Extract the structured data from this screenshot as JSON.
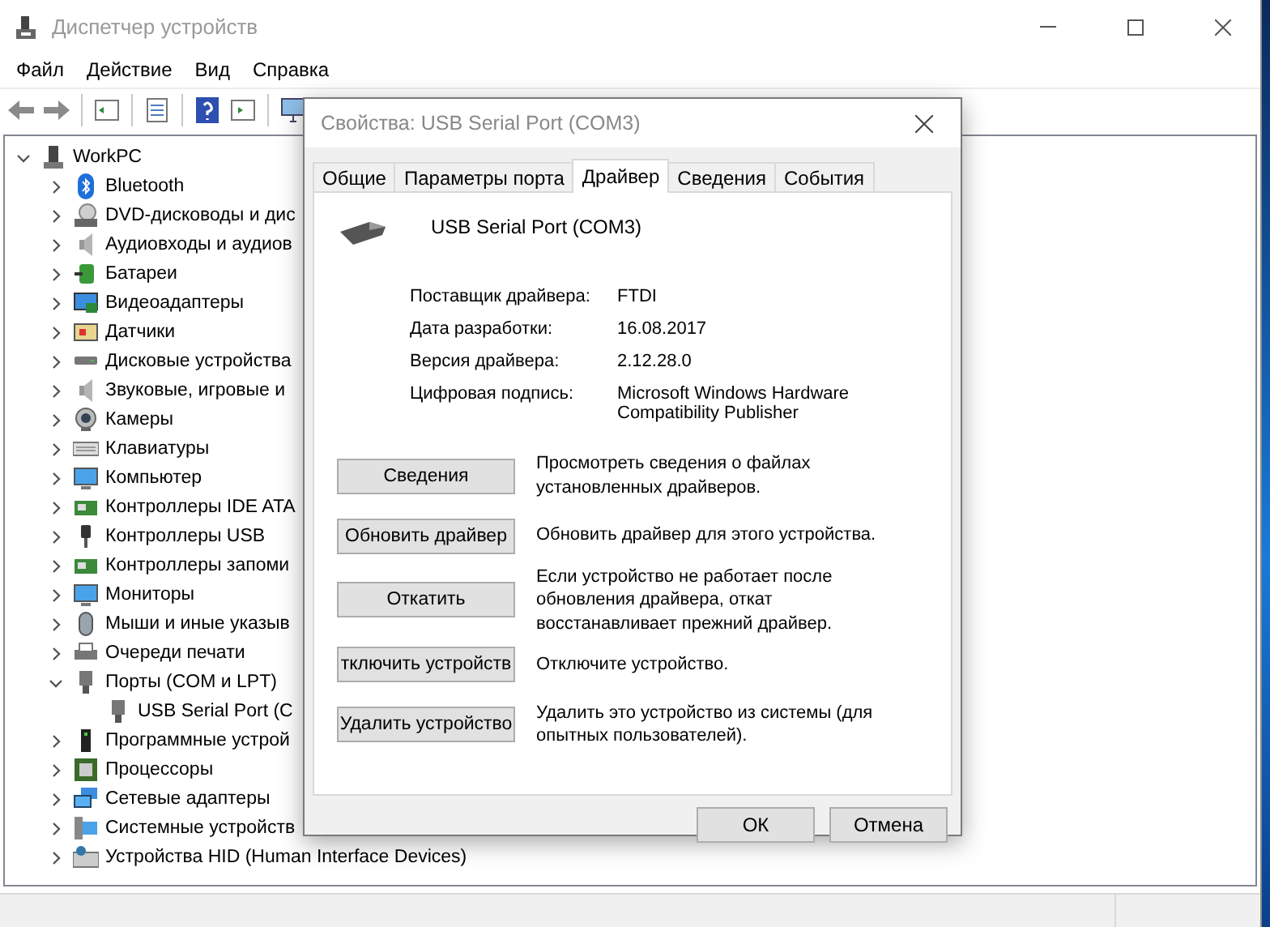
{
  "window": {
    "title": "Диспетчер устройств"
  },
  "menu": [
    "Файл",
    "Действие",
    "Вид",
    "Справка"
  ],
  "tree": {
    "label": "WorkPC",
    "expanded": true,
    "children": [
      {
        "label": "Bluetooth",
        "expanded": false
      },
      {
        "label": "DVD-дисководы и дис",
        "expanded": false
      },
      {
        "label": "Аудиовходы и аудиов",
        "expanded": false
      },
      {
        "label": "Батареи",
        "expanded": false
      },
      {
        "label": "Видеоадаптеры",
        "expanded": false
      },
      {
        "label": "Датчики",
        "expanded": false
      },
      {
        "label": "Дисковые устройства",
        "expanded": false
      },
      {
        "label": "Звуковые, игровые и",
        "expanded": false
      },
      {
        "label": "Камеры",
        "expanded": false
      },
      {
        "label": "Клавиатуры",
        "expanded": false
      },
      {
        "label": "Компьютер",
        "expanded": false
      },
      {
        "label": "Контроллеры IDE ATA",
        "expanded": false
      },
      {
        "label": "Контроллеры USB",
        "expanded": false
      },
      {
        "label": "Контроллеры запоми",
        "expanded": false
      },
      {
        "label": "Мониторы",
        "expanded": false
      },
      {
        "label": "Мыши и иные указыв",
        "expanded": false
      },
      {
        "label": "Очереди печати",
        "expanded": false
      },
      {
        "label": "Порты (COM и LPT)",
        "expanded": true,
        "children": [
          {
            "label": "USB Serial Port (C"
          }
        ]
      },
      {
        "label": "Программные устрой",
        "expanded": false
      },
      {
        "label": "Процессоры",
        "expanded": false
      },
      {
        "label": "Сетевые адаптеры",
        "expanded": false
      },
      {
        "label": "Системные устройств",
        "expanded": false
      },
      {
        "label": "Устройства HID (Human Interface Devices)",
        "expanded": false
      }
    ]
  },
  "dialog": {
    "title": "Свойства: USB Serial Port (COM3)",
    "tabs": [
      {
        "label": "Общие",
        "selected": false
      },
      {
        "label": "Параметры порта",
        "selected": false
      },
      {
        "label": "Драйвер",
        "selected": true
      },
      {
        "label": "Сведения",
        "selected": false
      },
      {
        "label": "События",
        "selected": false
      }
    ],
    "device_name": "USB Serial Port (COM3)",
    "properties": [
      {
        "label": "Поставщик драйвера:",
        "value": "FTDI"
      },
      {
        "label": "Дата разработки:",
        "value": "16.08.2017"
      },
      {
        "label": "Версия драйвера:",
        "value": "2.12.28.0"
      },
      {
        "label": "Цифровая подпись:",
        "value": "Microsoft Windows Hardware Compatibility Publisher"
      }
    ],
    "actions": [
      {
        "button": "Сведения",
        "description": "Просмотреть сведения о файлах установленных драйверов."
      },
      {
        "button": "Обновить драйвер",
        "description": "Обновить драйвер для этого устройства."
      },
      {
        "button": "Откатить",
        "description": "Если устройство не работает после обновления драйвера, откат восстанавливает прежний драйвер."
      },
      {
        "button": "тключить устройств",
        "description": "Отключите устройство."
      },
      {
        "button": "Удалить устройство",
        "description": "Удалить это устройство из системы (для опытных пользователей)."
      }
    ],
    "buttons": [
      "ОК",
      "Отмена"
    ]
  }
}
